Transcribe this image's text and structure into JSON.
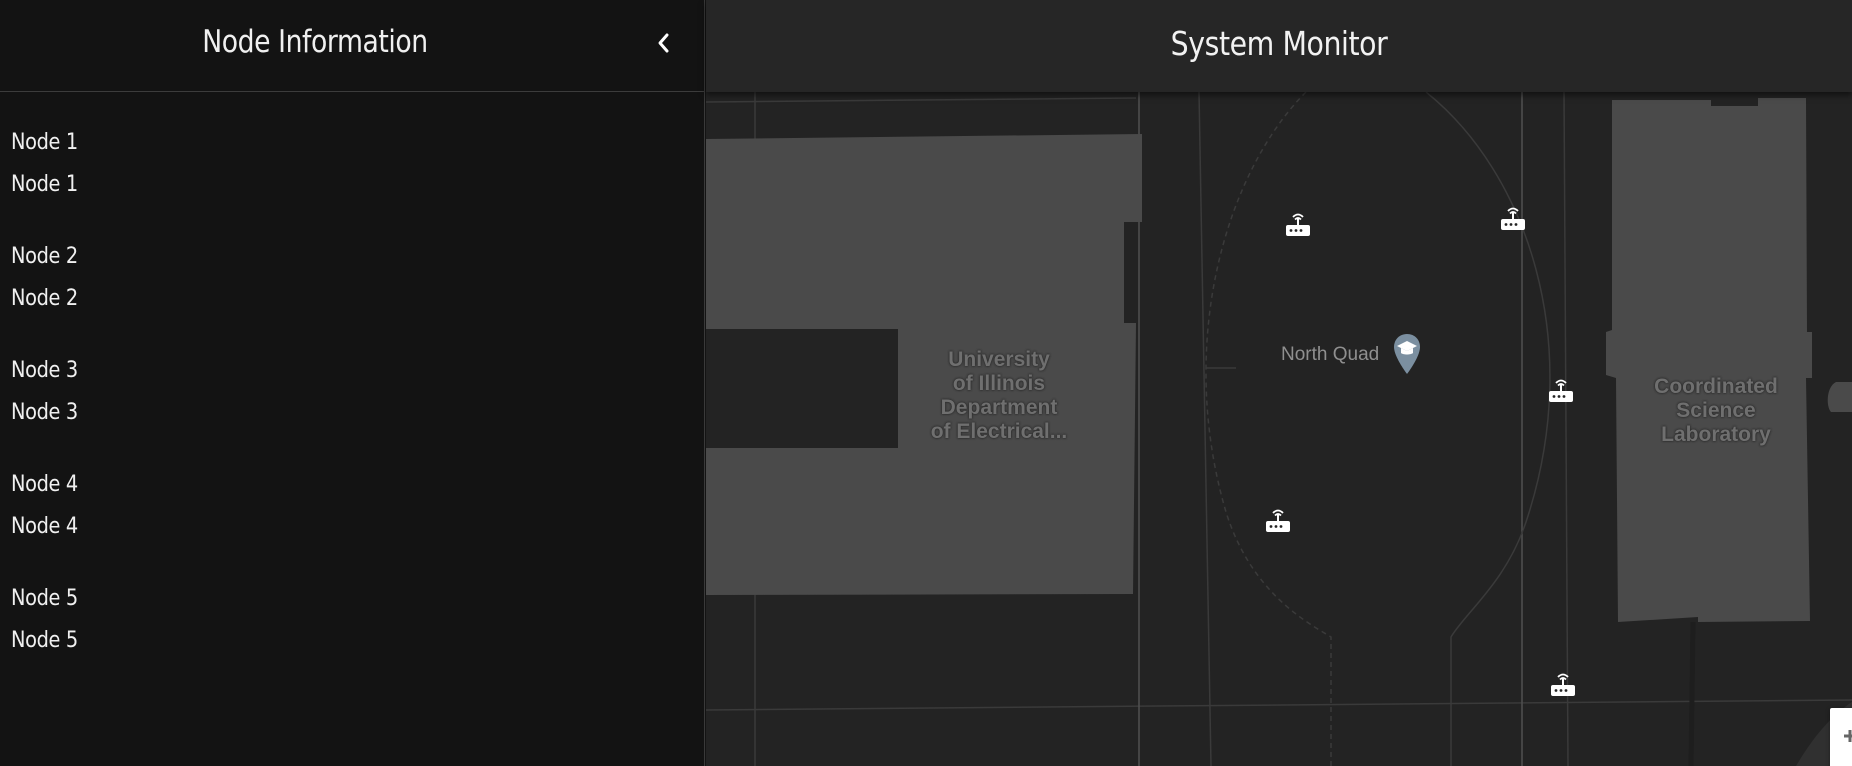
{
  "sidebar": {
    "title": "Node Information",
    "nodes": [
      {
        "name": "Node 1",
        "detail": "Node 1"
      },
      {
        "name": "Node 2",
        "detail": "Node 2"
      },
      {
        "name": "Node 3",
        "detail": "Node 3"
      },
      {
        "name": "Node 4",
        "detail": "Node 4"
      },
      {
        "name": "Node 5",
        "detail": "Node 5"
      }
    ]
  },
  "header": {
    "title": "System Monitor"
  },
  "map": {
    "labels": {
      "ece_building": "University\nof Illinois\nDepartment\nof Electrical...",
      "poi": "North Quad",
      "csl_building": "Coordinated\nScience\nLaboratory"
    },
    "icons": {
      "router": "wifi-router-icon",
      "poi": "graduation-cap-pin-icon",
      "collapse": "chevron-left-icon"
    },
    "colors": {
      "sidebar_bg": "#131313",
      "header_bg": "#262626",
      "map_bg": "#232323",
      "building": "#4a4a4a"
    }
  }
}
